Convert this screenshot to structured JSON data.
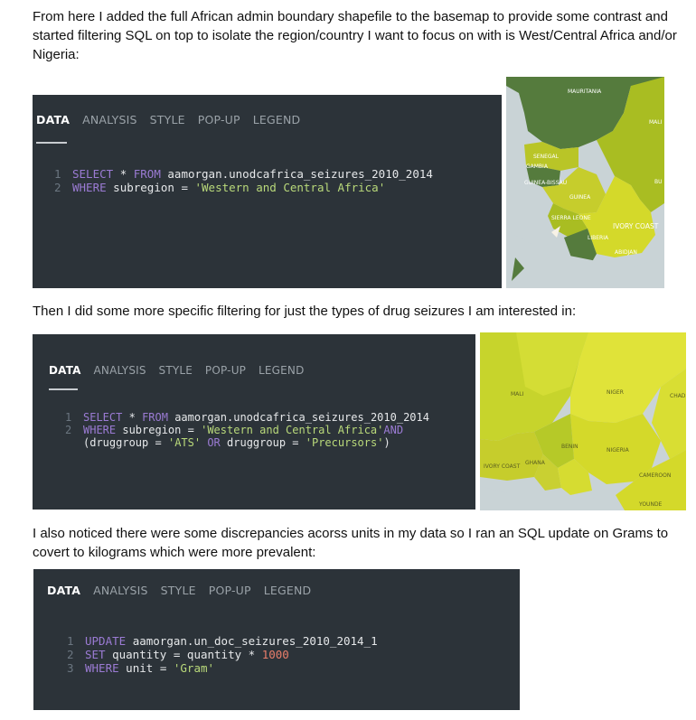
{
  "paragraphs": {
    "p1": "From here I added the full African admin boundary shapefile to the basemap to provide some contrast and started filtering SQL on top to isolate the region/country I want to focus on with is West/Central Africa and/or Nigeria:",
    "p2": "Then I did some more specific filtering for just the types of drug seizures I am interested in:",
    "p3": "I also noticed there were some discrepancies acorss units in my data so I ran an SQL update on Grams to covert to kilograms which were more prevalent:"
  },
  "tabs": [
    "DATA",
    "ANALYSIS",
    "STYLE",
    "POP-UP",
    "LEGEND"
  ],
  "panel1": {
    "ln1": "1",
    "ln2": "2",
    "select": "SELECT",
    "star": "*",
    "from": "FROM",
    "table": "aamorgan.unodcafrica_seizures_2010_2014",
    "where": "WHERE",
    "col": "subregion",
    "eq": "=",
    "value": "'Western and Central Africa'"
  },
  "panel2": {
    "ln1": "1",
    "ln2": "2",
    "select": "SELECT",
    "star": "*",
    "from": "FROM",
    "table": "aamorgan.unodcafrica_seizures_2010_2014",
    "where": "WHERE",
    "col": "subregion",
    "eq": "=",
    "value": "'Western and Central Africa'",
    "and": "AND",
    "paren_open": "(",
    "col2": "druggroup",
    "val2": "'ATS'",
    "or": "OR",
    "col3": "druggroup",
    "val3": "'Precursors'",
    "paren_close": ")"
  },
  "panel3": {
    "ln1": "1",
    "ln2": "2",
    "ln3": "3",
    "update": "UPDATE",
    "table": "aamorgan.un_doc_seizures_2010_2014_1",
    "set": "SET",
    "col": "quantity",
    "eq": "=",
    "col_b": "quantity",
    "mul": "*",
    "num": "1000",
    "where": "WHERE",
    "col2": "unit",
    "eq2": "=",
    "val": "'Gram'"
  },
  "map1_labels": {
    "mauritania": "MAURITANIA",
    "mali": "MALI",
    "senegal": "SENEGAL",
    "gambia": "GAMBIA",
    "guinea_bissau": "GUINEA-BISSAU",
    "guinea": "GUINEA",
    "sierra_leone": "SIERRA LEONE",
    "ivory_coast": "IVORY COAST",
    "liberia": "LIBERIA",
    "bf": "BU",
    "abidjan": "ABIDJAN"
  },
  "map2_labels": {
    "mali": "MALI",
    "niger": "NIGER",
    "nigeria": "NIGERIA",
    "ivory_coast": "IVORY COAST",
    "ghana": "GHANA",
    "cameroon": "CAMEROON",
    "yaounde": "YOUNDE",
    "benin": "BENIN",
    "chad": "CHAD"
  },
  "colors": {
    "panel_bg": "#2c3339",
    "keyword": "#9b7bd4",
    "string": "#b9d97a",
    "number": "#e87d6a",
    "map_dark_green": "#557b3d",
    "map_yellow": "#d4d92a",
    "map_water": "#c9d3d6"
  }
}
